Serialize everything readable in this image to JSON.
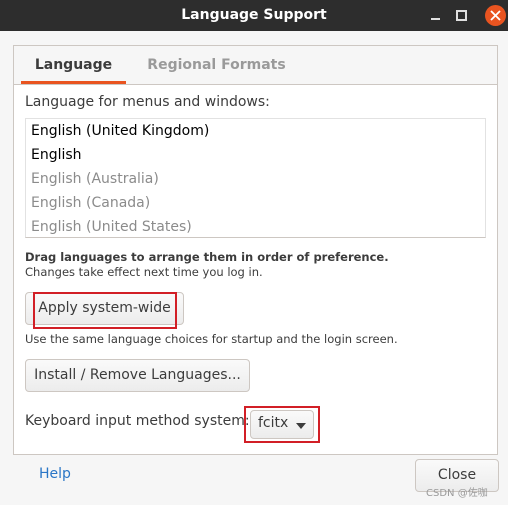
{
  "window": {
    "title": "Language Support"
  },
  "tabs": [
    {
      "label": "Language",
      "selected": true
    },
    {
      "label": "Regional Formats",
      "selected": false
    }
  ],
  "language_section": {
    "label": "Language for menus and windows:",
    "items": [
      {
        "label": "English (United Kingdom)",
        "active": true
      },
      {
        "label": "English",
        "active": true
      },
      {
        "label": "English (Australia)",
        "active": false
      },
      {
        "label": "English (Canada)",
        "active": false
      },
      {
        "label": "English (United States)",
        "active": false
      }
    ],
    "hint_bold": "Drag languages to arrange them in order of preference.",
    "hint": "Changes take effect next time you log in."
  },
  "apply_button": {
    "label": "Apply system-wide"
  },
  "apply_note": "Use the same language choices for startup and the login screen.",
  "install_button": {
    "label": "Install / Remove Languages..."
  },
  "keyboard": {
    "label": "Keyboard input method system:",
    "value": "fcitx"
  },
  "footer": {
    "help_label": "Help",
    "close_label": "Close"
  },
  "watermark": "CSDN @佐咖",
  "colors": {
    "accent": "#e95420",
    "highlight_box": "#d21f26",
    "link": "#2a76c6",
    "titlebar": "#2d2d2d"
  }
}
